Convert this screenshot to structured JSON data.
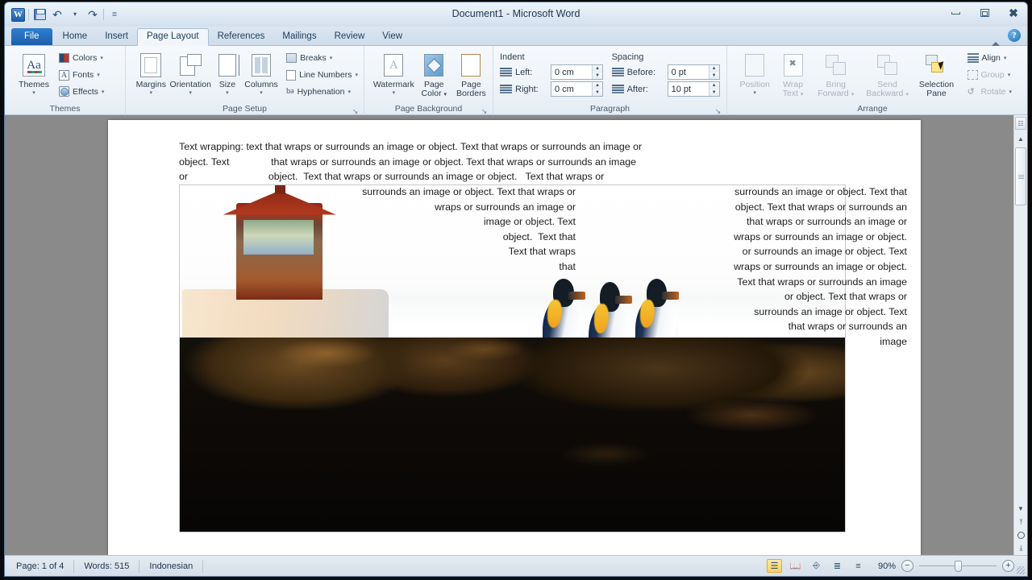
{
  "window": {
    "title": "Document1 - Microsoft Word",
    "quick_access": [
      {
        "name": "word-logo",
        "label": "W"
      },
      {
        "name": "save",
        "label": "Save"
      },
      {
        "name": "undo",
        "label": "↶"
      },
      {
        "name": "redo",
        "label": "↷"
      },
      {
        "name": "customize-qat",
        "label": "≡"
      }
    ],
    "controls": {
      "minimize": "Minimize",
      "maximize": "Maximize",
      "close": "Close"
    }
  },
  "tabs": [
    {
      "label": "File",
      "active": false,
      "style": "file"
    },
    {
      "label": "Home",
      "active": false
    },
    {
      "label": "Insert",
      "active": false
    },
    {
      "label": "Page Layout",
      "active": true
    },
    {
      "label": "References",
      "active": false
    },
    {
      "label": "Mailings",
      "active": false
    },
    {
      "label": "Review",
      "active": false
    },
    {
      "label": "View",
      "active": false
    }
  ],
  "ribbon": {
    "collapse_label": "▲",
    "help_label": "?",
    "groups": [
      {
        "name": "themes",
        "label": "Themes",
        "big": [
          {
            "label": "Themes",
            "arrow": "▾"
          }
        ],
        "small": [
          {
            "label": "Colors",
            "arrow": "▾"
          },
          {
            "label": "Fonts",
            "arrow": "▾"
          },
          {
            "label": "Effects",
            "arrow": "▾"
          }
        ]
      },
      {
        "name": "page-setup",
        "label": "Page Setup",
        "big": [
          {
            "label": "Margins",
            "arrow": "▾"
          },
          {
            "label": "Orientation",
            "arrow": "▾"
          },
          {
            "label": "Size",
            "arrow": "▾"
          },
          {
            "label": "Columns",
            "arrow": "▾"
          }
        ],
        "small": [
          {
            "label": "Breaks",
            "arrow": "▾"
          },
          {
            "label": "Line Numbers",
            "arrow": "▾"
          },
          {
            "label": "Hyphenation",
            "arrow": "▾"
          }
        ],
        "launcher": "↘"
      },
      {
        "name": "page-background",
        "label": "Page Background",
        "big": [
          {
            "label": "Watermark",
            "arrow": "▾"
          },
          {
            "label": "Page Color",
            "arrow": "▾"
          },
          {
            "label": "Page Borders",
            "arrow": ""
          }
        ]
      },
      {
        "name": "paragraph",
        "label": "Paragraph",
        "launcher": "↘",
        "indent": {
          "heading": "Indent",
          "left_label": "Left:",
          "left_value": "0 cm",
          "right_label": "Right:",
          "right_value": "0 cm"
        },
        "spacing": {
          "heading": "Spacing",
          "before_label": "Before:",
          "before_value": "0 pt",
          "after_label": "After:",
          "after_value": "10 pt"
        }
      },
      {
        "name": "arrange",
        "label": "Arrange",
        "big": [
          {
            "label": "Position",
            "arrow": "▾",
            "disabled": true
          },
          {
            "label": "Wrap Text",
            "arrow": "▾",
            "disabled": true
          },
          {
            "label": "Bring Forward",
            "arrow": "▾",
            "disabled": true
          },
          {
            "label": "Send Backward",
            "arrow": "▾",
            "disabled": true
          },
          {
            "label": "Selection Pane",
            "arrow": "",
            "disabled": false
          }
        ],
        "small": [
          {
            "label": "Align",
            "arrow": "▾",
            "disabled": false
          },
          {
            "label": "Group",
            "arrow": "▾",
            "disabled": true
          },
          {
            "label": "Rotate",
            "arrow": "▾",
            "disabled": true
          }
        ]
      }
    ]
  },
  "document": {
    "lines": [
      "Text wrapping: text that wraps or surrounds an image or object. Text that wraps or surrounds an image or",
      "object. Text               that wraps or surrounds an image or object. Text that wraps or surrounds an image",
      "or                             object.  Text that wraps or surrounds an image or object.   Text that wraps or"
    ],
    "middle_column": [
      "surrounds an image or object. Text that wraps or",
      "wraps or surrounds an image or",
      "image or object. Text",
      "object.  Text that",
      "Text that wraps",
      "that"
    ],
    "right_column": [
      "surrounds an image or object. Text that",
      "object. Text that wraps or surrounds an",
      "that wraps or surrounds an image or",
      "wraps or surrounds an image or object.",
      "or surrounds an image or object. Text",
      "wraps or surrounds an image or object.",
      "Text that wraps or surrounds an image",
      "or object. Text that wraps or",
      "surrounds an image or object. Text",
      "that wraps or surrounds an",
      "image"
    ]
  },
  "status_bar": {
    "page": "Page: 1 of 4",
    "words": "Words: 515",
    "language": "Indonesian",
    "views": [
      {
        "name": "print-layout-view",
        "glyph": "☰",
        "active": true
      },
      {
        "name": "full-screen-reading-view",
        "glyph": "📖",
        "active": false
      },
      {
        "name": "web-layout-view",
        "glyph": "⎆",
        "active": false
      },
      {
        "name": "outline-view",
        "glyph": "≣",
        "active": false
      },
      {
        "name": "draft-view",
        "glyph": "≡",
        "active": false
      }
    ],
    "zoom_level": "90%",
    "zoom_out": "−",
    "zoom_in": "+"
  },
  "colors": {
    "accent": "#1f5fa8",
    "ribbon_bg": "#eef3f8",
    "desk_bg": "#8a8a8a",
    "file_tab": "#1c5fa8",
    "highlight": "#f8cf62"
  }
}
